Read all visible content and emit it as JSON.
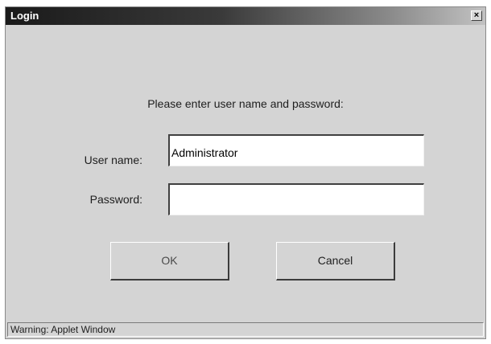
{
  "window": {
    "title": "Login",
    "close_glyph": "×"
  },
  "form": {
    "prompt": "Please enter user name and password:",
    "username_label": "User name:",
    "username_value": "Administrator",
    "password_label": "Password:",
    "password_value": ""
  },
  "buttons": {
    "ok_label": "OK",
    "cancel_label": "Cancel"
  },
  "status_bar": {
    "text": "Warning: Applet Window"
  }
}
